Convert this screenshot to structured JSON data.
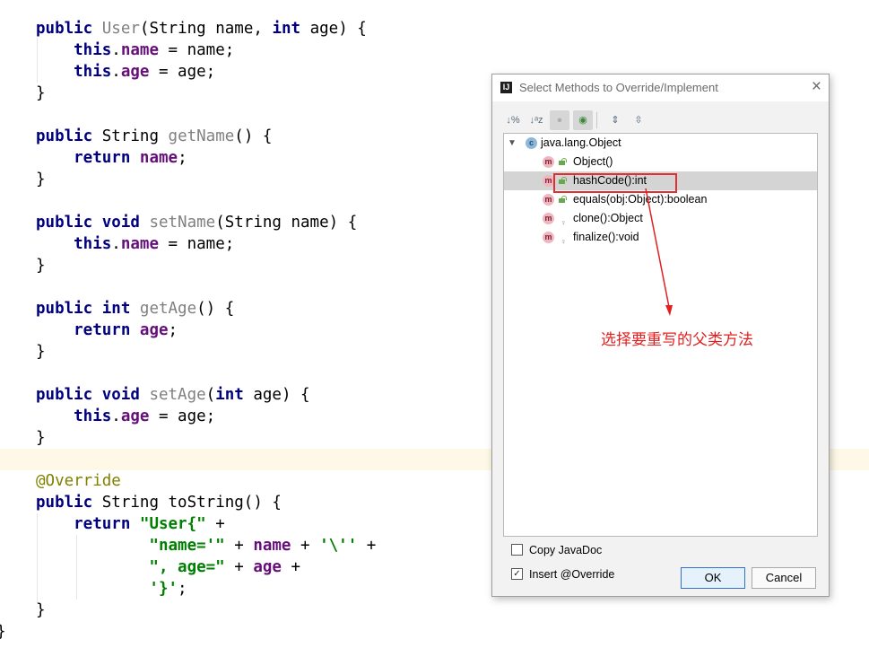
{
  "code": {
    "lines": [
      {
        "t": [
          {
            "c": "kw",
            "v": "public "
          },
          {
            "c": "mdecl",
            "v": "User"
          },
          {
            "c": "",
            "v": "("
          },
          {
            "c": "",
            "v": "String name, "
          },
          {
            "c": "kw",
            "v": "int "
          },
          {
            "c": "",
            "v": "age) {"
          }
        ]
      },
      {
        "t": [
          {
            "c": "kw",
            "v": "    this"
          },
          {
            "c": "",
            "v": "."
          },
          {
            "c": "fld",
            "v": "name"
          },
          {
            "c": "",
            "v": " = name;"
          }
        ]
      },
      {
        "t": [
          {
            "c": "kw",
            "v": "    this"
          },
          {
            "c": "",
            "v": "."
          },
          {
            "c": "fld",
            "v": "age"
          },
          {
            "c": "",
            "v": " = age;"
          }
        ]
      },
      {
        "t": [
          {
            "c": "",
            "v": "}"
          }
        ]
      },
      {
        "t": []
      },
      {
        "t": [
          {
            "c": "kw",
            "v": "public "
          },
          {
            "c": "",
            "v": "String "
          },
          {
            "c": "mdecl",
            "v": "getName"
          },
          {
            "c": "",
            "v": "() {"
          }
        ]
      },
      {
        "t": [
          {
            "c": "kw",
            "v": "    return "
          },
          {
            "c": "fld",
            "v": "name"
          },
          {
            "c": "",
            "v": ";"
          }
        ]
      },
      {
        "t": [
          {
            "c": "",
            "v": "}"
          }
        ]
      },
      {
        "t": []
      },
      {
        "t": [
          {
            "c": "kw",
            "v": "public void "
          },
          {
            "c": "mdecl",
            "v": "setName"
          },
          {
            "c": "",
            "v": "(String name) {"
          }
        ]
      },
      {
        "t": [
          {
            "c": "kw",
            "v": "    this"
          },
          {
            "c": "",
            "v": "."
          },
          {
            "c": "fld",
            "v": "name"
          },
          {
            "c": "",
            "v": " = name;"
          }
        ]
      },
      {
        "t": [
          {
            "c": "",
            "v": "}"
          }
        ]
      },
      {
        "t": []
      },
      {
        "t": [
          {
            "c": "kw",
            "v": "public int "
          },
          {
            "c": "mdecl",
            "v": "getAge"
          },
          {
            "c": "",
            "v": "() {"
          }
        ]
      },
      {
        "t": [
          {
            "c": "kw",
            "v": "    return "
          },
          {
            "c": "fld",
            "v": "age"
          },
          {
            "c": "",
            "v": ";"
          }
        ]
      },
      {
        "t": [
          {
            "c": "",
            "v": "}"
          }
        ]
      },
      {
        "t": []
      },
      {
        "t": [
          {
            "c": "kw",
            "v": "public void "
          },
          {
            "c": "mdecl",
            "v": "setAge"
          },
          {
            "c": "",
            "v": "("
          },
          {
            "c": "kw",
            "v": "int "
          },
          {
            "c": "",
            "v": "age) {"
          }
        ]
      },
      {
        "t": [
          {
            "c": "kw",
            "v": "    this"
          },
          {
            "c": "",
            "v": "."
          },
          {
            "c": "fld",
            "v": "age"
          },
          {
            "c": "",
            "v": " = age;"
          }
        ]
      },
      {
        "t": [
          {
            "c": "",
            "v": "}"
          }
        ]
      },
      {
        "t": []
      },
      {
        "t": [
          {
            "c": "ann",
            "v": "@Override"
          }
        ]
      },
      {
        "t": [
          {
            "c": "kw",
            "v": "public "
          },
          {
            "c": "",
            "v": "String toString() {"
          }
        ]
      },
      {
        "t": [
          {
            "c": "kw",
            "v": "    return "
          },
          {
            "c": "str",
            "v": "\"User{\""
          },
          {
            "c": "",
            "v": " +"
          }
        ]
      },
      {
        "t": [
          {
            "c": "str",
            "v": "            \"name='\""
          },
          {
            "c": "",
            "v": " + "
          },
          {
            "c": "fld",
            "v": "name"
          },
          {
            "c": "",
            "v": " + "
          },
          {
            "c": "str",
            "v": "'\\''"
          },
          {
            "c": "",
            "v": " +"
          }
        ]
      },
      {
        "t": [
          {
            "c": "str",
            "v": "            \", age=\""
          },
          {
            "c": "",
            "v": " + "
          },
          {
            "c": "fld",
            "v": "age"
          },
          {
            "c": "",
            "v": " +"
          }
        ]
      },
      {
        "t": [
          {
            "c": "str",
            "v": "            '}'"
          },
          {
            "c": "",
            "v": ";"
          }
        ]
      },
      {
        "t": [
          {
            "c": "",
            "v": "}"
          }
        ]
      },
      {
        "t": [
          {
            "c": "",
            "v": "}"
          }
        ]
      }
    ]
  },
  "dialog": {
    "title": "Select Methods to Override/Implement",
    "tree": {
      "root": "java.lang.Object",
      "methods": [
        {
          "label": "Object()",
          "visibility": "public",
          "selected": false
        },
        {
          "label": "hashCode():int",
          "visibility": "public",
          "selected": true
        },
        {
          "label": "equals(obj:Object):boolean",
          "visibility": "public",
          "selected": false
        },
        {
          "label": "clone():Object",
          "visibility": "protected",
          "selected": false
        },
        {
          "label": "finalize():void",
          "visibility": "protected",
          "selected": false
        }
      ]
    },
    "copy_javadoc": "Copy JavaDoc",
    "insert_override": "Insert @Override",
    "ok": "OK",
    "cancel": "Cancel"
  },
  "annotation": "选择要重写的父类方法",
  "colors": {
    "annotation": "#e02020",
    "primary_button_border": "#2f74c8"
  }
}
